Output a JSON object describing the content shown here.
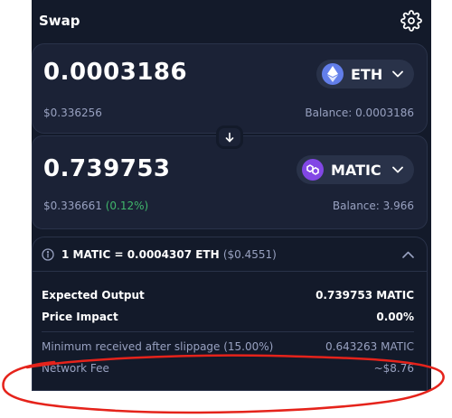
{
  "header": {
    "title": "Swap",
    "settings_icon": "gear-icon"
  },
  "input": {
    "amount": "0.0003186",
    "usd_value": "$0.336256",
    "balance": "Balance: 0.0003186",
    "token": {
      "symbol": "ETH",
      "icon": "ethereum-icon",
      "color": "#627eea"
    }
  },
  "output": {
    "amount": "0.739753",
    "usd_value": "$0.336661",
    "usd_change": "(0.12%)",
    "balance": "Balance: 3.966",
    "token": {
      "symbol": "MATIC",
      "icon": "polygon-icon",
      "color": "#8247e5"
    }
  },
  "rate": {
    "text": "1 MATIC = 0.0004307 ETH",
    "fiat": "($0.4551)"
  },
  "details": {
    "expected_output_label": "Expected Output",
    "expected_output_value": "0.739753 MATIC",
    "price_impact_label": "Price Impact",
    "price_impact_value": "0.00%",
    "min_received_label": "Minimum received after slippage (15.00%)",
    "min_received_value": "0.643263 MATIC",
    "network_fee_label": "Network Fee",
    "network_fee_value": "~$8.76"
  },
  "colors": {
    "background": "#131a2a",
    "card": "#1b2236",
    "border": "#293249",
    "muted_text": "#98a1c0",
    "positive": "#40b66b",
    "annotation": "#e5231b"
  }
}
